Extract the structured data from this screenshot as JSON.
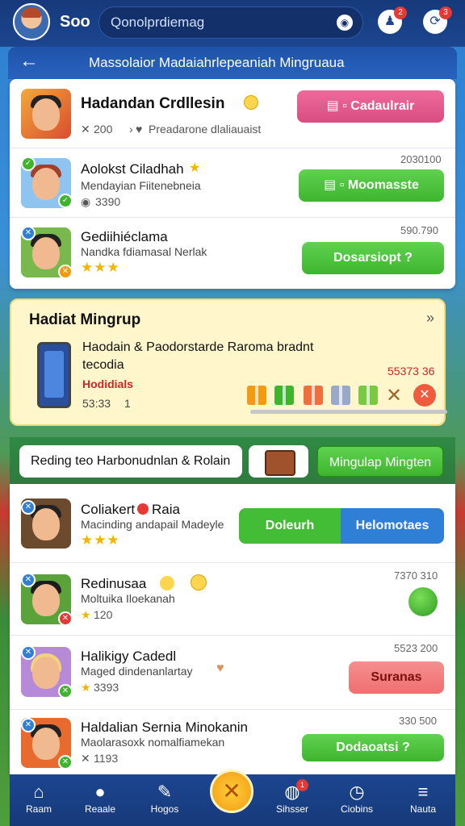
{
  "app": {
    "brand": "Soo",
    "search_value": "Qonolprdiemag",
    "notifications_badge": "2",
    "updates_badge": "3"
  },
  "header": {
    "title": "Massolaior Madaiahrlepeaniah Mingruaua"
  },
  "featured": {
    "name": "Hadandan Crdllesin",
    "count": "200",
    "desc": "Preadarone dlaliauaist",
    "button": "Cadaulrair"
  },
  "list_top": [
    {
      "name": "Aolokst Ciladhah",
      "sub": "Mendayian Fiitenebneia",
      "meta": "3390",
      "time": "2030100",
      "button": "Moomasste"
    },
    {
      "name": "Gediihiéclama",
      "sub": "Nandka fdiamasal Nerlak",
      "meta": "",
      "time": "590.790",
      "button": "Dosarsiopt ?",
      "stars": "★★★"
    }
  ],
  "weekly": {
    "title": "Hadiat Mingrup",
    "line1": "Haodain & Paodorstarde Raroma bradnt",
    "line2": "tecodia",
    "highlight": "Hodidials",
    "counter": "53:33",
    "counter2": "1",
    "amount": "55373 36"
  },
  "filter": {
    "input_value": "Reding teo Harbonudnlan & Rolain",
    "toggle_label": "Mingulap Mingten"
  },
  "list_bottom": [
    {
      "name": "Coliakert",
      "tag": "Raia",
      "sub": "Macinding andapail Madeyle",
      "stars": "★★★",
      "left_btn": "Doleurh",
      "right_btn": "Helomotaes"
    },
    {
      "name": "Redinusaa",
      "sub": "Moltuika Iloekanah",
      "meta": "120",
      "time": "7370 310"
    },
    {
      "name": "Halikigy Cadedl",
      "sub": "Maged dindenanlartay",
      "meta": "3393",
      "time": "5523 200",
      "button": "Suranas"
    },
    {
      "name": "Haldalian Sernia Minokanin",
      "sub": "Maolarasoxk nomalfiamekan",
      "meta": "1193",
      "time": "330 500",
      "button": "Dodaoatsi ?"
    }
  ],
  "nav": [
    {
      "label": "Raam",
      "icon": "home-icon",
      "glyph": "⌂"
    },
    {
      "label": "Reaale",
      "icon": "person-icon",
      "glyph": "●"
    },
    {
      "label": "Hogos",
      "icon": "edit-icon",
      "glyph": "✎"
    },
    {
      "label": "Sihsser",
      "icon": "globe-icon",
      "glyph": "◍",
      "badge": "1"
    },
    {
      "label": "Ciobins",
      "icon": "clock-icon",
      "glyph": "◷"
    },
    {
      "label": "Nauta",
      "icon": "menu-icon",
      "glyph": "≡"
    }
  ],
  "colors": {
    "primary": "#1c4690",
    "green": "#43bd36",
    "pink": "#d94d82",
    "blue": "#2f7fd6",
    "warning": "#fff6cc"
  }
}
